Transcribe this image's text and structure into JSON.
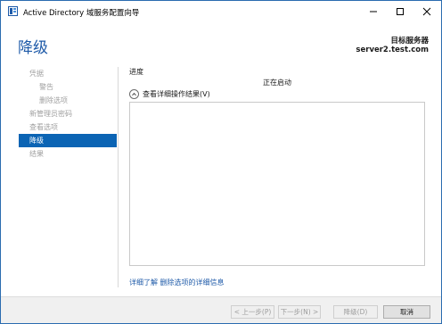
{
  "window": {
    "title": "Active Directory 域服务配置向导"
  },
  "header": {
    "page_title": "降级",
    "target_label": "目标服务器",
    "target_server": "server2.test.com"
  },
  "nav": {
    "items": [
      {
        "label": "凭据",
        "state": "disabled"
      },
      {
        "label": "警告",
        "state": "disabled"
      },
      {
        "label": "删除选项",
        "state": "disabled"
      },
      {
        "label": "新管理员密码",
        "state": "disabled"
      },
      {
        "label": "查看选项",
        "state": "disabled"
      },
      {
        "label": "降级",
        "state": "active"
      },
      {
        "label": "结果",
        "state": "disabled"
      }
    ]
  },
  "main": {
    "progress_label": "进度",
    "status_text": "正在启动",
    "details_toggle_label": "查看详细操作结果(V)",
    "more_link": "详细了解 删除选项的详细信息"
  },
  "footer": {
    "prev_label": "< 上一步(P)",
    "next_label": "下一步(N) >",
    "demote_label": "降级(D)",
    "cancel_label": "取消"
  },
  "colors": {
    "accent": "#1e5aa8",
    "nav_active": "#0b64b4",
    "window_border": "#2b6cb0"
  }
}
